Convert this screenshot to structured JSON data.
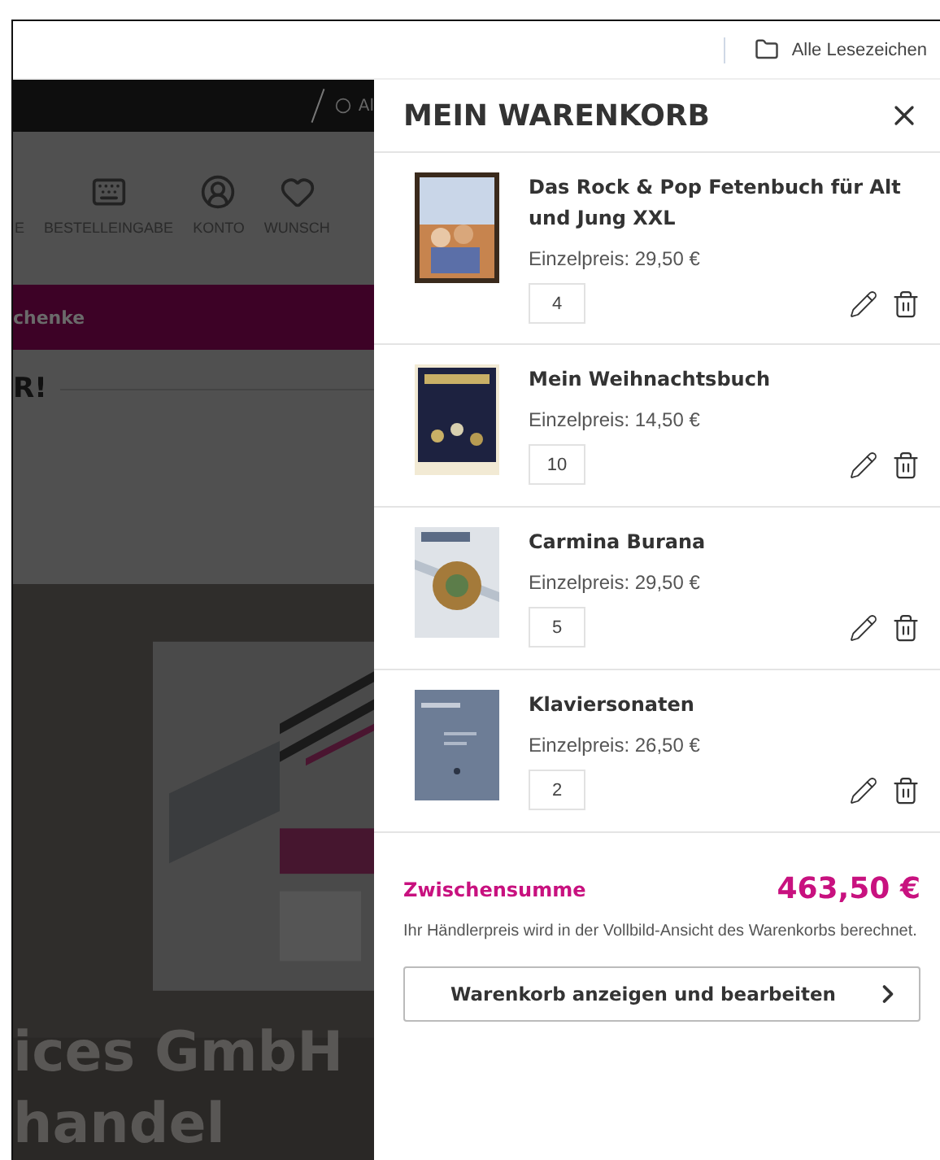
{
  "bookmarks_bar": {
    "label": "Alle Lesezeichen"
  },
  "background_page": {
    "top_bar_text": "Al",
    "nav_items": [
      {
        "label": "E",
        "kind": "text"
      },
      {
        "label": "BESTELLEINGABE",
        "kind": "keyboard"
      },
      {
        "label": "KONTO",
        "kind": "user"
      },
      {
        "label": "WUNSCH",
        "kind": "heart"
      }
    ],
    "promo_bar": "chenke",
    "heading": "R!",
    "banner_lines": [
      "ices GmbH",
      "handel"
    ]
  },
  "cart": {
    "title": "MEIN WARENKORB",
    "items": [
      {
        "title": "Das Rock & Pop Fetenbuch für Alt und Jung XXL",
        "unit_price": "Einzelpreis: 29,50 €",
        "quantity": "4"
      },
      {
        "title": "Mein Weihnachtsbuch",
        "unit_price": "Einzelpreis: 14,50 €",
        "quantity": "10"
      },
      {
        "title": "Carmina Burana",
        "unit_price": "Einzelpreis: 29,50 €",
        "quantity": "5"
      },
      {
        "title": "Klaviersonaten",
        "unit_price": "Einzelpreis: 26,50 €",
        "quantity": "2"
      }
    ],
    "subtotal_label": "Zwischensumme",
    "subtotal_value": "463,50 €",
    "note": "Ihr Händlerpreis wird in der Vollbild-Ansicht des Warenkorbs berechnet.",
    "button": "Warenkorb anzeigen und bearbeiten"
  }
}
